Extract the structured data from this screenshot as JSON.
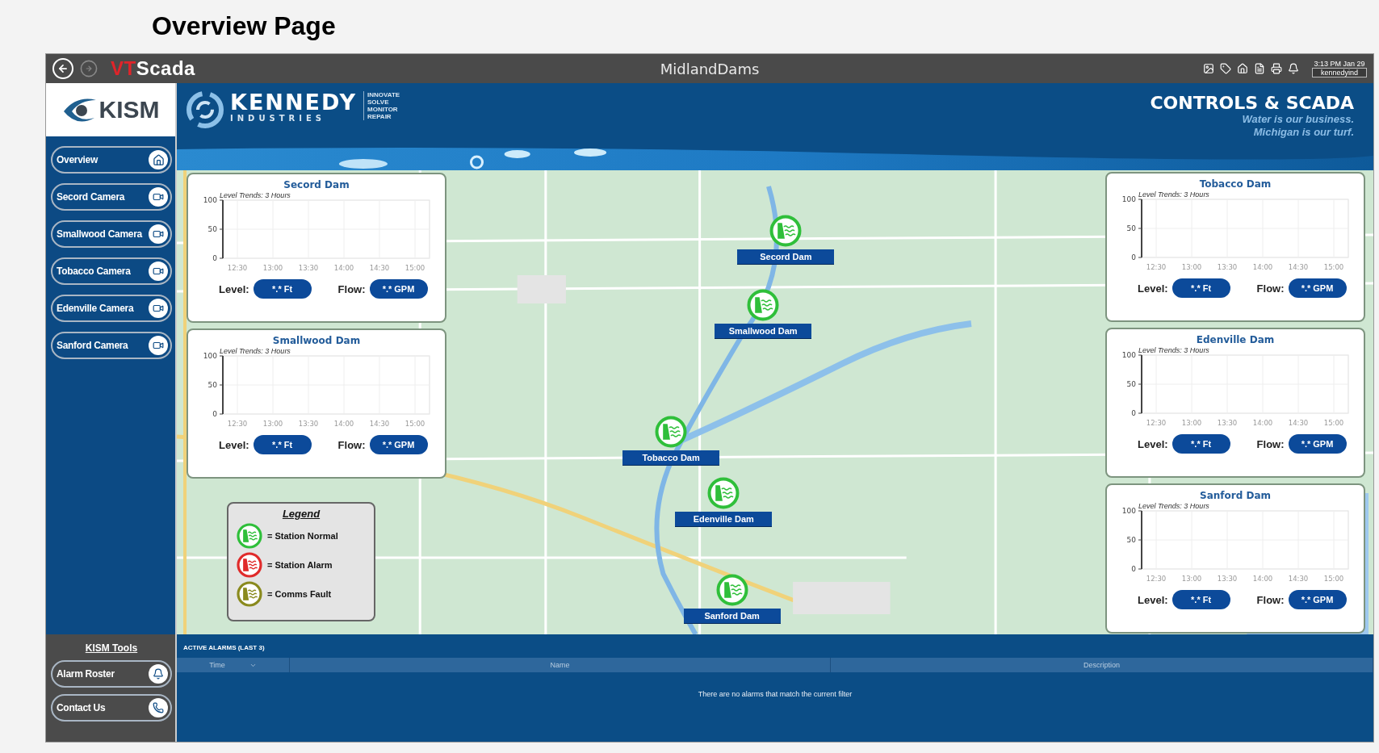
{
  "page_title": "Overview Page",
  "titlebar": {
    "nav": [
      {
        "kind": "back",
        "disabled": false
      },
      {
        "kind": "forward",
        "disabled": true
      }
    ],
    "logo_prefix": "VT",
    "logo_suffix": "Scada",
    "title": "MidlandDams",
    "time": "3:13 PM  Jan 29",
    "user": "kennedyind"
  },
  "brand": {
    "kism": "KISM",
    "company": "KENNEDY",
    "company_sub": "INDUSTRIES",
    "motto": [
      "INNOVATE",
      "SOLVE",
      "MONITOR",
      "REPAIR"
    ],
    "headline": "CONTROLS & SCADA",
    "tagline": [
      "Water is our business.",
      "Michigan is our turf."
    ]
  },
  "sidebar": {
    "items": [
      {
        "label": "Overview"
      },
      {
        "label": "Secord Camera"
      },
      {
        "label": "Smallwood Camera"
      },
      {
        "label": "Tobacco Camera"
      },
      {
        "label": "Edenville Camera"
      },
      {
        "label": "Sanford Camera"
      }
    ]
  },
  "panels": [
    {
      "name": "Secord Dam",
      "level_label": "Level:",
      "level_value": "*.* Ft",
      "flow_label": "Flow:",
      "flow_value": "*.* GPM",
      "chart_data": {
        "type": "line",
        "title": "Level Trends: 3 Hours",
        "categories": [
          "12:30",
          "13:00",
          "13:30",
          "14:00",
          "14:30",
          "15:00"
        ],
        "ylim": [
          0,
          100
        ],
        "yticks": [
          0,
          50,
          100
        ],
        "grid": true
      }
    },
    {
      "name": "Smallwood Dam",
      "level_label": "Level:",
      "level_value": "*.* Ft",
      "flow_label": "Flow:",
      "flow_value": "*.* GPM",
      "chart_data": {
        "type": "line",
        "title": "Level Trends: 3 Hours",
        "categories": [
          "12:30",
          "13:00",
          "13:30",
          "14:00",
          "14:30",
          "15:00"
        ],
        "ylim": [
          0,
          100
        ],
        "yticks": [
          0,
          50,
          100
        ],
        "grid": true
      }
    },
    {
      "name": "Tobacco Dam",
      "level_label": "Level:",
      "level_value": "*.* Ft",
      "flow_label": "Flow:",
      "flow_value": "*.* GPM",
      "chart_data": {
        "type": "line",
        "title": "Level Trends: 3 Hours",
        "categories": [
          "12:30",
          "13:00",
          "13:30",
          "14:00",
          "14:30",
          "15:00"
        ],
        "ylim": [
          0,
          100
        ],
        "yticks": [
          0,
          50,
          100
        ],
        "grid": true
      }
    },
    {
      "name": "Edenville Dam",
      "level_label": "Level:",
      "level_value": "*.* Ft",
      "flow_label": "Flow:",
      "flow_value": "*.* GPM",
      "chart_data": {
        "type": "line",
        "title": "Level Trends: 3 Hours",
        "categories": [
          "12:30",
          "13:00",
          "13:30",
          "14:00",
          "14:30",
          "15:00"
        ],
        "ylim": [
          0,
          100
        ],
        "yticks": [
          0,
          50,
          100
        ],
        "grid": true
      }
    },
    {
      "name": "Sanford Dam",
      "level_label": "Level:",
      "level_value": "*.* Ft",
      "flow_label": "Flow:",
      "flow_value": "*.* GPM",
      "chart_data": {
        "type": "line",
        "title": "Level Trends: 3 Hours",
        "categories": [
          "12:30",
          "13:00",
          "13:30",
          "14:00",
          "14:30",
          "15:00"
        ],
        "ylim": [
          0,
          100
        ],
        "yticks": [
          0,
          50,
          100
        ],
        "grid": true
      }
    }
  ],
  "stations": [
    {
      "name": "Secord Dam"
    },
    {
      "name": "Smallwood Dam"
    },
    {
      "name": "Tobacco Dam"
    },
    {
      "name": "Edenville Dam"
    },
    {
      "name": "Sanford Dam"
    }
  ],
  "legend": {
    "title": "Legend",
    "items": [
      {
        "label": "= Station Normal",
        "color": "#2fbf3a"
      },
      {
        "label": "= Station Alarm",
        "color": "#e02b2b"
      },
      {
        "label": "= Comms Fault",
        "color": "#8a8a1e"
      }
    ]
  },
  "tools": {
    "title": "KISM Tools",
    "items": [
      {
        "label": "Alarm Roster"
      },
      {
        "label": "Contact Us"
      }
    ]
  },
  "alarms": {
    "title": "ACTIVE ALARMS (LAST 3)",
    "columns": [
      {
        "label": "Time",
        "sorted": true
      },
      {
        "label": "Name",
        "sorted": false
      },
      {
        "label": "Description",
        "sorted": false
      }
    ],
    "empty_message": "There are no alarms that match the current filter"
  }
}
